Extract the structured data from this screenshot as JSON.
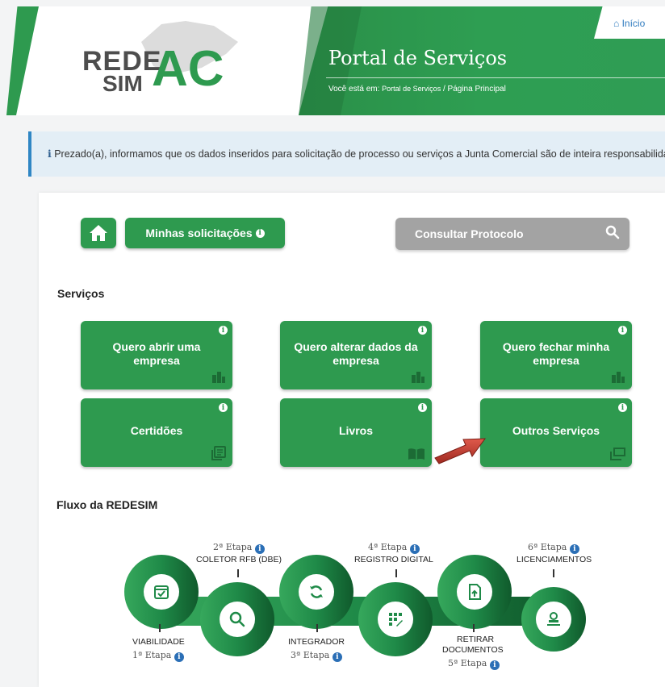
{
  "header": {
    "inicio_label": "Início",
    "logo_rede": "REDE",
    "logo_sim": "SIM",
    "logo_ac": "AC",
    "portal_title": "Portal de Serviços",
    "breadcrumb_prefix": "Você está em: ",
    "breadcrumb_portal": "Portal de Serviços",
    "breadcrumb_sep": " / ",
    "breadcrumb_current": "Página Principal"
  },
  "alert": {
    "icon": "i",
    "text": " Prezado(a), informamos que os dados inseridos para solicitação de processo ou serviços a Junta Comercial são de inteira responsabilidade"
  },
  "actions": {
    "minhas_label": "Minhas solicitações",
    "consultar_label": "Consultar Protocolo"
  },
  "servicos": {
    "title": "Serviços",
    "items": [
      {
        "label": "Quero abrir uma empresa",
        "icon": "buildings-icon"
      },
      {
        "label": "Quero alterar dados da empresa",
        "icon": "buildings-icon"
      },
      {
        "label": "Quero fechar minha empresa",
        "icon": "buildings-icon"
      },
      {
        "label": "Certidões",
        "icon": "documents-icon"
      },
      {
        "label": "Livros",
        "icon": "book-icon"
      },
      {
        "label": "Outros Serviços",
        "icon": "windows-icon"
      }
    ]
  },
  "fluxo": {
    "title": "Fluxo da REDESIM",
    "steps": [
      {
        "name": "VIABILIDADE",
        "etapa": "1ª Etapa"
      },
      {
        "name": "COLETOR RFB (DBE)",
        "etapa": "2ª Etapa"
      },
      {
        "name": "INTEGRADOR",
        "etapa": "3ª Etapa"
      },
      {
        "name": "REGISTRO DIGITAL",
        "etapa": "4ª Etapa"
      },
      {
        "name": "RETIRAR",
        "name2": "DOCUMENTOS",
        "etapa": "5ª Etapa"
      },
      {
        "name": "LICENCIAMENTOS",
        "etapa": "6ª Etapa"
      }
    ]
  },
  "colors": {
    "primary": "#2e9a4f",
    "info": "#2f86c4",
    "gray_button": "#a3a3a3",
    "red_arrow": "#c0392b"
  }
}
